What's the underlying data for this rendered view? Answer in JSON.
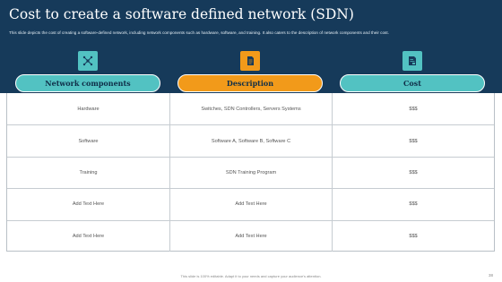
{
  "header": {
    "title": "Cost to create a software defined network (SDN)",
    "subtitle": "This slide depicts the cost of creating a software-defined network, including network components such as hardware, software, and training. It also caters to the description of network components and their cost."
  },
  "columns": [
    {
      "label": "Network components",
      "icon": "network-icon",
      "color": "#52c2c2"
    },
    {
      "label": "Description",
      "icon": "document-icon",
      "color": "#f29a1a"
    },
    {
      "label": "Cost",
      "icon": "invoice-icon",
      "color": "#52c2c2"
    }
  ],
  "rows": [
    [
      "Hardware",
      "Switches, SDN Controllers, Servers Systems",
      "$$$"
    ],
    [
      "Software",
      "Software A, Software B, Software C",
      "$$$"
    ],
    [
      "Training",
      "SDN Training Program",
      "$$$"
    ],
    [
      "Add Text Here",
      "Add Text Here",
      "$$$"
    ],
    [
      "Add Text Here",
      "Add Text Here",
      "$$$"
    ]
  ],
  "footer": {
    "note": "This slide is 100% editable. Adapt it to your needs and capture your audience's attention.",
    "page_number": "38"
  },
  "colors": {
    "banner": "#163a5a",
    "teal": "#52c2c2",
    "orange": "#f29a1a"
  }
}
